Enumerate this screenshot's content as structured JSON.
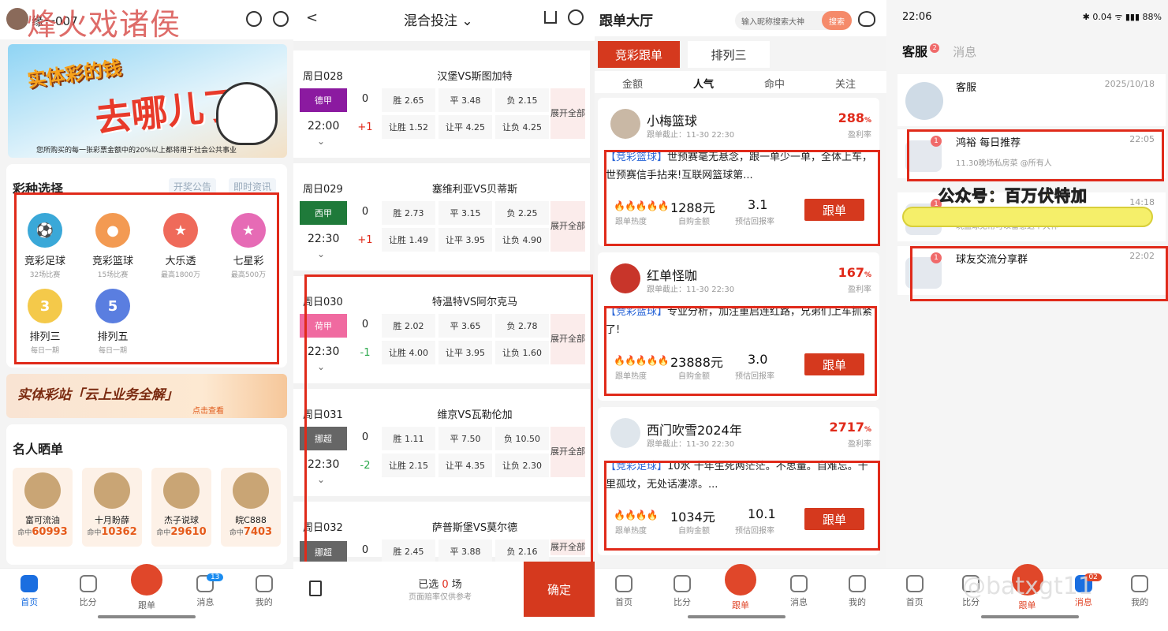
{
  "p1": {
    "user": "缘一007",
    "watermark": "烽火戏诸侯",
    "banner": {
      "line1": "实体彩的钱",
      "line2": "去哪儿了?",
      "caption": "您所购买的每一张彩票金额中的20%以上都将用于社会公共事业"
    },
    "section_title": "彩种选择",
    "tab_notice": "开奖公告",
    "tab_news": "即时资讯",
    "lotteries": [
      {
        "name": "竞彩足球",
        "sub": "32场比赛",
        "color": "#3aa8d8",
        "glyph": "⚽"
      },
      {
        "name": "竞彩篮球",
        "sub": "15场比赛",
        "color": "#f39a52",
        "glyph": "●"
      },
      {
        "name": "大乐透",
        "sub": "最高1800万",
        "color": "#ef6a5a",
        "glyph": "★"
      },
      {
        "name": "七星彩",
        "sub": "最高500万",
        "color": "#e66bb5",
        "glyph": "★"
      },
      {
        "name": "排列三",
        "sub": "每日一期",
        "color": "#f4c94a",
        "glyph": "3"
      },
      {
        "name": "排列五",
        "sub": "每日一期",
        "color": "#5a7ee0",
        "glyph": "5"
      }
    ],
    "promo": {
      "title": "实体彩站「云上业务全解」",
      "link": "点击查看"
    },
    "stars_title": "名人晒单",
    "stars": [
      {
        "name": "富可流油",
        "hit_label": "命中",
        "hit": "60993"
      },
      {
        "name": "十月盼薛",
        "hit_label": "命中",
        "hit": "10362"
      },
      {
        "name": "杰子说球",
        "hit_label": "命中",
        "hit": "29610"
      },
      {
        "name": "皖C888",
        "hit_label": "命中",
        "hit": "7403"
      }
    ],
    "tabs": [
      "首页",
      "比分",
      "跟单",
      "消息",
      "我的"
    ],
    "msg_badge": "13"
  },
  "p2": {
    "back": "<",
    "title": "混合投注 ⌄",
    "matches": [
      {
        "date": "周日028",
        "home": "汉堡",
        "away": "斯图加特",
        "league": "德甲",
        "lg_color": "#8b1aa0",
        "time": "22:00",
        "hc": "+1",
        "hc_color": "#e02a1a",
        "odds": [
          "胜 2.65",
          "平 3.48",
          "负 2.15",
          "让胜 1.52",
          "让平 4.25",
          "让负 4.25"
        ]
      },
      {
        "date": "周日029",
        "home": "塞维利亚",
        "away": "贝蒂斯",
        "league": "西甲",
        "lg_color": "#1f7a3a",
        "time": "22:30",
        "hc": "+1",
        "hc_color": "#e02a1a",
        "odds": [
          "胜 2.73",
          "平 3.15",
          "负 2.25",
          "让胜 1.49",
          "让平 3.95",
          "让负 4.90"
        ]
      },
      {
        "date": "周日030",
        "home": "特温特",
        "away": "阿尔克马",
        "league": "荷甲",
        "lg_color": "#f06aa0",
        "time": "22:30",
        "hc": "-1",
        "hc_color": "#2aa84a",
        "odds": [
          "胜 2.02",
          "平 3.65",
          "负 2.78",
          "让胜 4.00",
          "让平 3.95",
          "让负 1.60"
        ]
      },
      {
        "date": "周日031",
        "home": "维京",
        "away": "瓦勒伦加",
        "league": "挪超",
        "lg_color": "#666666",
        "time": "22:30",
        "hc": "-2",
        "hc_color": "#2aa84a",
        "odds": [
          "胜 1.11",
          "平 7.50",
          "负 10.50",
          "让胜 2.15",
          "让平 4.35",
          "让负 2.30"
        ]
      },
      {
        "date": "周日032",
        "home": "萨普斯堡",
        "away": "莫尔德",
        "league": "挪超",
        "lg_color": "#666666",
        "time": "",
        "hc": "",
        "hc_color": "#2aa84a",
        "odds": [
          "胜 2.45",
          "平 3.88",
          "负 2.16",
          "",
          "",
          ""
        ]
      }
    ],
    "vs": "VS",
    "more": "展开全部",
    "hc0": "0",
    "selected_prefix": "已选",
    "selected_count": "0",
    "selected_suffix": "场",
    "note": "页面赔率仅供参考",
    "confirm": "确定"
  },
  "p3": {
    "title": "跟单大厅",
    "search_placeholder": "输入昵称搜索大神",
    "search_btn": "搜索",
    "tab_active": "竞彩跟单",
    "tab_other": "排列三",
    "subtabs": [
      "金额",
      "人气",
      "命中",
      "关注"
    ],
    "posts": [
      {
        "name": "小梅篮球",
        "deadline": "跟单截止：11-30 22:30",
        "rate": "288",
        "rate_unit": "%",
        "rate_label": "盈利率",
        "kind": "【竞彩篮球】",
        "text": "世预赛毫无悬念，跟一单少一单，全体上车，世预赛信手拈来!互联网篮球第...",
        "flames": "🔥🔥🔥🔥🔥",
        "amount": "1288元",
        "amount_label": "自购金额",
        "ret": "3.1",
        "ret_label": "预估回报率",
        "heat_label": "跟单热度"
      },
      {
        "name": "红单怪咖",
        "deadline": "跟单截止：11-30 22:30",
        "rate": "167",
        "rate_unit": "%",
        "rate_label": "盈利率",
        "kind": "【竞彩篮球】",
        "text": "专业分析，加注重启连红路，兄弟们上车抓紧了!",
        "flames": "🔥🔥🔥🔥🔥",
        "amount": "23888元",
        "amount_label": "自购金额",
        "ret": "3.0",
        "ret_label": "预估回报率",
        "heat_label": "跟单热度"
      },
      {
        "name": "西门吹雪2024年",
        "deadline": "跟单截止：11-30 22:30",
        "rate": "2717",
        "rate_unit": "%",
        "rate_label": "盈利率",
        "kind": "【竞彩足球】",
        "text": "10水 十年生死两茫茫。不思量。自难忘。千里孤坟，无处话凄凉。...",
        "flames": "🔥🔥🔥🔥",
        "amount": "1034元",
        "amount_label": "自购金额",
        "ret": "10.1",
        "ret_label": "预估回报率",
        "heat_label": "跟单热度"
      }
    ],
    "follow": "跟单",
    "tabs": [
      "首页",
      "比分",
      "跟单",
      "消息",
      "我的"
    ]
  },
  "p4": {
    "time": "22:06",
    "status_right": "✱ 0.04 ᯤ ▮▮▮ 88%",
    "tab_service": "客服",
    "service_badge": "2",
    "tab_msg": "消息",
    "chats": [
      {
        "name": "客服",
        "time": "2025/10/18",
        "msg": "",
        "dot": ""
      },
      {
        "name": "鸿裕 每日推荐",
        "time": "22:05",
        "msg": "11.30晚场私房菜 @所有人",
        "dot": "1"
      },
      {
        "name": "",
        "time": "14:18",
        "msg": "玩篮球无常可以留意这个大神",
        "dot": "1"
      },
      {
        "name": "球友交流分享群",
        "time": "22:02",
        "msg": "",
        "dot": "1"
      }
    ],
    "overlay": "公众号：百万伏特加",
    "watermark2": "@batxgt11",
    "tabs": [
      "首页",
      "比分",
      "跟单",
      "消息",
      "我的"
    ],
    "msg_badge": "02"
  }
}
